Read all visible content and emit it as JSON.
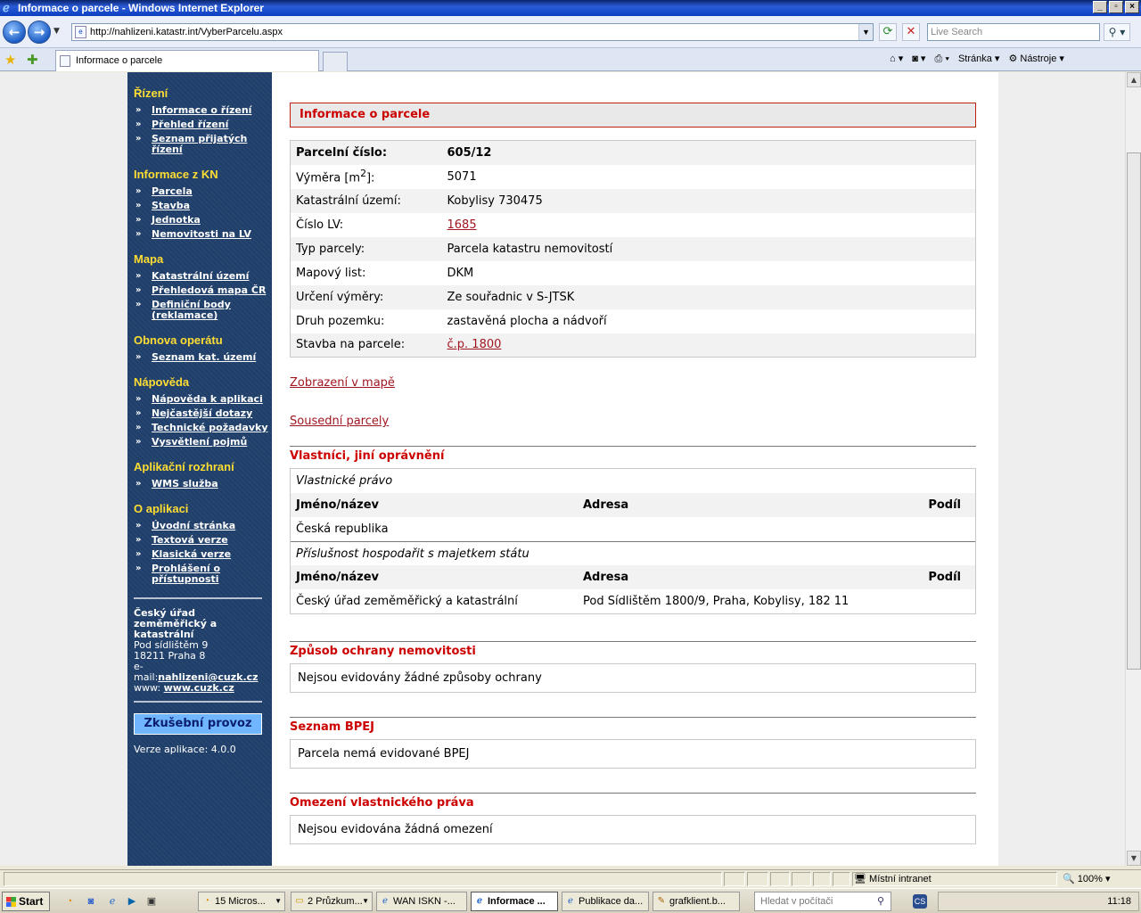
{
  "window": {
    "title": "Informace o parcele - Windows Internet Explorer",
    "url": "http://nahlizeni.katastr.int/VyberParcelu.aspx",
    "search_placeholder": "Live Search",
    "tab_title": "Informace o parcele",
    "tools": {
      "page": "Stránka",
      "tools": "Nástroje"
    }
  },
  "sidebar": {
    "sections": [
      {
        "heading": "Řízení",
        "items": [
          "Informace o řízení",
          "Přehled řízení",
          "Seznam přijatých řízení"
        ]
      },
      {
        "heading": "Informace z KN",
        "items": [
          "Parcela",
          "Stavba",
          "Jednotka",
          "Nemovitosti na LV"
        ]
      },
      {
        "heading": "Mapa",
        "items": [
          "Katastrální území",
          "Přehledová mapa ČR",
          "Definiční body (reklamace)"
        ]
      },
      {
        "heading": "Obnova operátu",
        "items": [
          "Seznam kat. území"
        ]
      },
      {
        "heading": "Nápověda",
        "items": [
          "Nápověda k aplikaci",
          "Nejčastější dotazy",
          "Technické požadavky",
          "Vysvětlení pojmů"
        ]
      },
      {
        "heading": "Aplikační rozhraní",
        "items": [
          "WMS služba"
        ]
      },
      {
        "heading": "O aplikaci",
        "items": [
          "Úvodní stránka",
          "Textová verze",
          "Klasická verze",
          "Prohlášení o přístupnosti"
        ]
      }
    ],
    "contact": {
      "org": "Český úřad zeměměřický a katastrální",
      "street": "Pod sídlištěm 9",
      "city": "18211 Praha 8",
      "email_label": "e-mail:",
      "email": "nahlizeni@cuzk.cz",
      "www_label": "www:",
      "www": "www.cuzk.cz"
    },
    "test_badge": "Zkušební provoz",
    "version": "Verze aplikace: 4.0.0"
  },
  "main": {
    "header": "Informace o parcele",
    "properties": [
      {
        "key": "Parcelní číslo:",
        "value": "605/12",
        "link": false
      },
      {
        "key": "Výměra [m",
        "key_sup": "2",
        "key_end": "]:",
        "value": "5071",
        "link": false
      },
      {
        "key": "Katastrální území:",
        "value": "Kobylisy 730475",
        "link": false
      },
      {
        "key": "Číslo LV:",
        "value": "1685",
        "link": true
      },
      {
        "key": "Typ parcely:",
        "value": "Parcela katastru nemovitostí",
        "link": false
      },
      {
        "key": "Mapový list:",
        "value": "DKM",
        "link": false
      },
      {
        "key": "Určení výměry:",
        "value": "Ze souřadnic v S-JTSK",
        "link": false
      },
      {
        "key": "Druh pozemku:",
        "value": "zastavěná plocha a nádvoří",
        "link": false
      },
      {
        "key": "Stavba na parcele:",
        "value": "č.p. 1800",
        "link": true
      }
    ],
    "map_link": "Zobrazení v mapě",
    "neighbors_link": "Sousední parcely",
    "owners": {
      "title": "Vlastníci, jiní oprávnění",
      "groups": [
        {
          "type": "Vlastnické právo",
          "headers": [
            "Jméno/název",
            "Adresa",
            "Podíl"
          ],
          "rows": [
            {
              "name": "Česká republika",
              "address": "",
              "share": ""
            }
          ]
        },
        {
          "type": "Příslušnost hospodařit s majetkem státu",
          "headers": [
            "Jméno/název",
            "Adresa",
            "Podíl"
          ],
          "rows": [
            {
              "name": "Český úřad zeměměřický a katastrální",
              "address": "Pod Sídlištěm 1800/9, Praha, Kobylisy, 182 11",
              "share": ""
            }
          ]
        }
      ]
    },
    "protection": {
      "title": "Způsob ochrany nemovitosti",
      "text": "Nejsou evidovány žádné způsoby ochrany"
    },
    "bpej": {
      "title": "Seznam BPEJ",
      "text": "Parcela nemá evidované BPEJ"
    },
    "restrictions": {
      "title": "Omezení vlastnického práva",
      "text": "Nejsou evidována žádná omezení"
    }
  },
  "statusbar": {
    "zone": "Místní intranet",
    "zoom": "100%"
  },
  "taskbar": {
    "start": "Start",
    "tasks": [
      "15 Micros...",
      "2 Průzkum...",
      "WAN ISKN -...",
      "Informace ...",
      "Publikace da...",
      "grafklient.b..."
    ],
    "search_placeholder": "Hledat v počítači",
    "lang": "CS",
    "clock": "11:18"
  }
}
